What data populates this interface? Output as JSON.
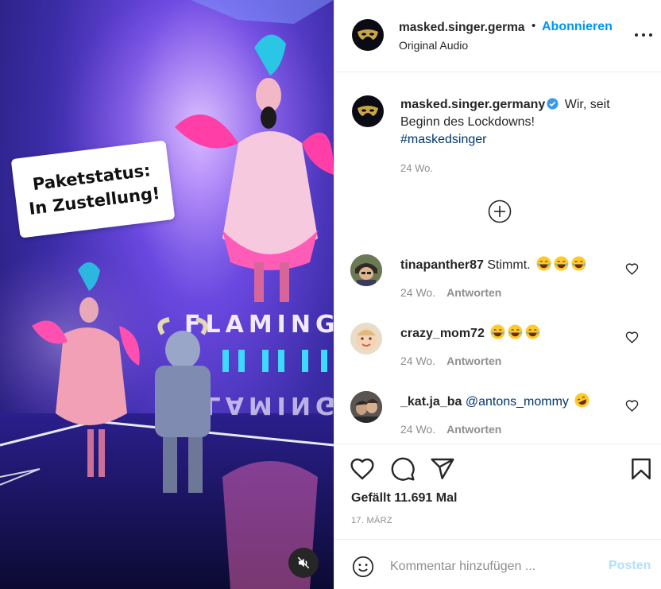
{
  "post": {
    "username": "masked.singer.germany",
    "header_username_visible": "masked.singer.germa",
    "follow_label": "Abonnieren",
    "audio_label": "Original Audio",
    "bullet": "•"
  },
  "video": {
    "sticker_line1": "Paketstatus:",
    "sticker_line2": "In Zustellung!",
    "stage_text": "FLAMINGO",
    "mute_icon": "speaker-muted-icon"
  },
  "caption": {
    "username": "masked.singer.germany",
    "text": "Wir, seit Beginn des Lockdowns!",
    "hashtag": "#maskedsinger",
    "time": "24 Wo."
  },
  "comments": [
    {
      "username": "tinapanther87",
      "text": "Stimmt.",
      "emojis": [
        "😂",
        "😂",
        "😂"
      ],
      "time": "24 Wo.",
      "reply_label": "Antworten"
    },
    {
      "username": "crazy_mom72",
      "text": "",
      "emojis": [
        "😂",
        "😂",
        "😂"
      ],
      "time": "24 Wo.",
      "reply_label": "Antworten"
    },
    {
      "username": "_kat.ja_ba",
      "mention": "@antons_mommy",
      "emojis": [
        "🤣"
      ],
      "time": "24 Wo.",
      "reply_label": "Antworten"
    }
  ],
  "actions": {
    "likes": "Gefällt 11.691 Mal",
    "date": "17. MÄRZ"
  },
  "comment_box": {
    "placeholder": "Kommentar hinzufügen ...",
    "post_label": "Posten"
  },
  "colors": {
    "accent": "#0095f6",
    "link": "#00376b",
    "muted": "#8e8e8e",
    "post_disabled": "#b2dffc"
  }
}
